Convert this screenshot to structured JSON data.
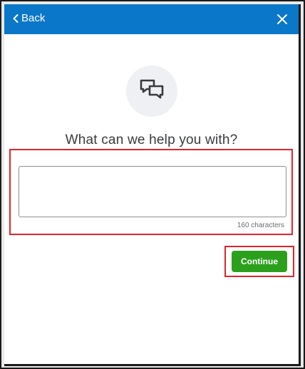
{
  "header": {
    "back_label": "Back",
    "back_icon": "chevron-left-icon",
    "close_icon": "close-icon",
    "background_color": "#0a77c8"
  },
  "main": {
    "chat_icon": "chat-bubbles-icon",
    "heading": "What can we help you with?",
    "message_value": "",
    "message_placeholder": "",
    "char_counter": "160 characters",
    "continue_label": "Continue",
    "continue_color": "#2ca01c",
    "highlight_color": "#e0232b"
  }
}
